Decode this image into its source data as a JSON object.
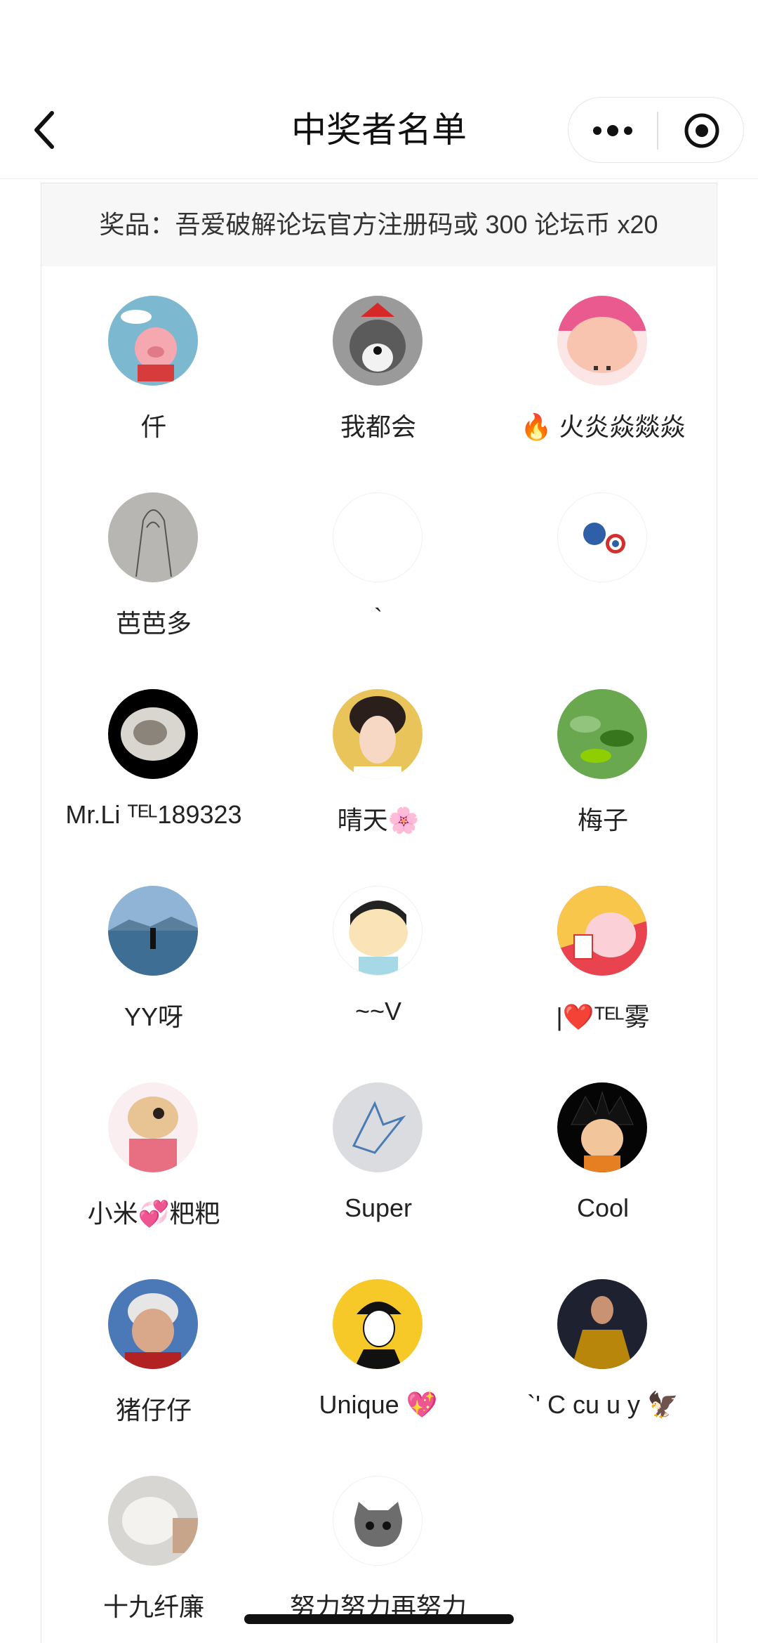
{
  "navbar": {
    "title": "中奖者名单"
  },
  "prize": {
    "text": "奖品：吾爱破解论坛官方注册码或 300 论坛币 x20"
  },
  "winners": [
    {
      "name": "仟",
      "avatar": "pig-cartoon-avatar"
    },
    {
      "name": "我都会",
      "avatar": "husky-dog-avatar"
    },
    {
      "name": "🔥 火炎焱燚焱",
      "avatar": "pink-cartoon-face-avatar"
    },
    {
      "name": "芭芭多",
      "avatar": "sketch-drawing-avatar"
    },
    {
      "name": "`",
      "avatar": "blank-white-avatar"
    },
    {
      "name": "",
      "avatar": "captain-america-avatar"
    },
    {
      "name": "Mr.Li ᵀᴱᴸ189323",
      "avatar": "wolf-rock-avatar"
    },
    {
      "name": "晴天🌸",
      "avatar": "anime-boy-avatar"
    },
    {
      "name": "梅子",
      "avatar": "green-plant-avatar"
    },
    {
      "name": "YY呀",
      "avatar": "lake-person-avatar"
    },
    {
      "name": "~~V",
      "avatar": "crayon-shin-chan-avatar"
    },
    {
      "name": "|❤️ᵀᴱᴸ雾",
      "avatar": "pink-pig-red-avatar"
    },
    {
      "name": "小米💞粑粑",
      "avatar": "cartoon-bear-avatar"
    },
    {
      "name": "Super",
      "avatar": "blue-dragon-sketch-avatar"
    },
    {
      "name": "Cool",
      "avatar": "goku-avatar"
    },
    {
      "name": "猪仔仔",
      "avatar": "grandma-photo-avatar"
    },
    {
      "name": "Unique 💖",
      "avatar": "boy-black-cap-avatar"
    },
    {
      "name": "`' C cu u y 🦅",
      "avatar": "footballer-avatar"
    },
    {
      "name": "十九纤廉",
      "avatar": "white-kitten-avatar"
    },
    {
      "name": "努力努力再努力",
      "avatar": "gray-cat-avatar"
    }
  ]
}
